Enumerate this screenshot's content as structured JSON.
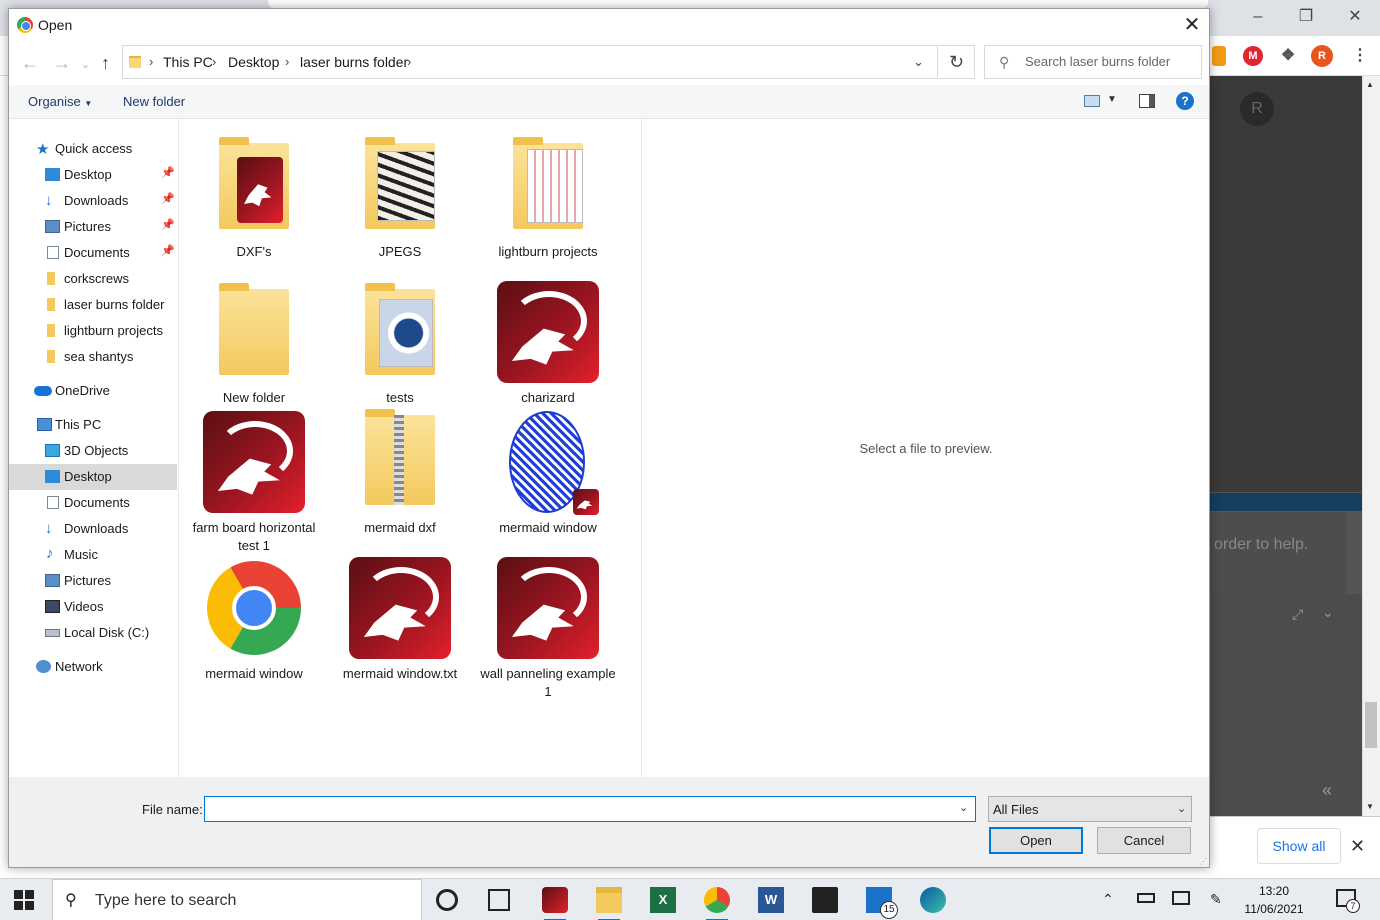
{
  "dialog": {
    "title": "Open",
    "breadcrumbs": [
      "This PC",
      "Desktop",
      "laser burns folder"
    ],
    "search_placeholder": "Search laser burns folder",
    "commands": {
      "organise": "Organise",
      "new_folder": "New folder"
    },
    "preview_text": "Select a file to preview.",
    "file_name_label": "File name:",
    "file_name_value": "",
    "filter_value": "All Files",
    "open_label": "Open",
    "cancel_label": "Cancel"
  },
  "sidebar": {
    "quick_access": "Quick access",
    "qa_items": [
      {
        "label": "Desktop",
        "icon": "desktop-icon",
        "pinned": true
      },
      {
        "label": "Downloads",
        "icon": "download-icon",
        "pinned": true
      },
      {
        "label": "Pictures",
        "icon": "pictures-icon",
        "pinned": true
      },
      {
        "label": "Documents",
        "icon": "documents-icon",
        "pinned": true
      },
      {
        "label": "corkscrews",
        "icon": "folder-icon",
        "pinned": false
      },
      {
        "label": "laser burns folder",
        "icon": "folder-icon",
        "pinned": false
      },
      {
        "label": "lightburn projects",
        "icon": "folder-icon",
        "pinned": false
      },
      {
        "label": "sea shantys",
        "icon": "folder-icon",
        "pinned": false
      }
    ],
    "onedrive": "OneDrive",
    "this_pc": "This PC",
    "pc_items": [
      {
        "label": "3D Objects",
        "icon": "cube-icon"
      },
      {
        "label": "Desktop",
        "icon": "desktop-icon",
        "selected": true
      },
      {
        "label": "Documents",
        "icon": "documents-icon"
      },
      {
        "label": "Downloads",
        "icon": "download-icon"
      },
      {
        "label": "Music",
        "icon": "music-icon"
      },
      {
        "label": "Pictures",
        "icon": "pictures-icon"
      },
      {
        "label": "Videos",
        "icon": "videos-icon"
      },
      {
        "label": "Local Disk (C:)",
        "icon": "disk-icon"
      }
    ],
    "network": "Network"
  },
  "files": [
    {
      "name": "DXF's",
      "type": "folder-dragon"
    },
    {
      "name": "JPEGS",
      "type": "folder-jpegs"
    },
    {
      "name": "lightburn projects",
      "type": "folder-drawing"
    },
    {
      "name": "New folder",
      "type": "folder-empty"
    },
    {
      "name": "tests",
      "type": "folder-tests"
    },
    {
      "name": "charizard",
      "type": "lightburn-file"
    },
    {
      "name": "farm board horizontal test 1",
      "type": "lightburn-file"
    },
    {
      "name": "mermaid dxf",
      "type": "zip-folder"
    },
    {
      "name": "mermaid window",
      "type": "ship-image"
    },
    {
      "name": "mermaid window",
      "type": "chrome-file"
    },
    {
      "name": "mermaid window.txt",
      "type": "lightburn-file"
    },
    {
      "name": "wall panneling example 1",
      "type": "lightburn-file"
    }
  ],
  "background": {
    "page_text": "order to help.",
    "show_all": "Show all",
    "profile_initial": "R"
  },
  "taskbar": {
    "search_text": "Type here to search",
    "time": "13:20",
    "date": "11/06/2021",
    "mail_badge": "15",
    "notif_badge": "7"
  },
  "colors": {
    "selection": "#cce8ff",
    "accent": "#0078d7",
    "folder": "#f4c95d",
    "dragon_red": "#9b1521"
  }
}
